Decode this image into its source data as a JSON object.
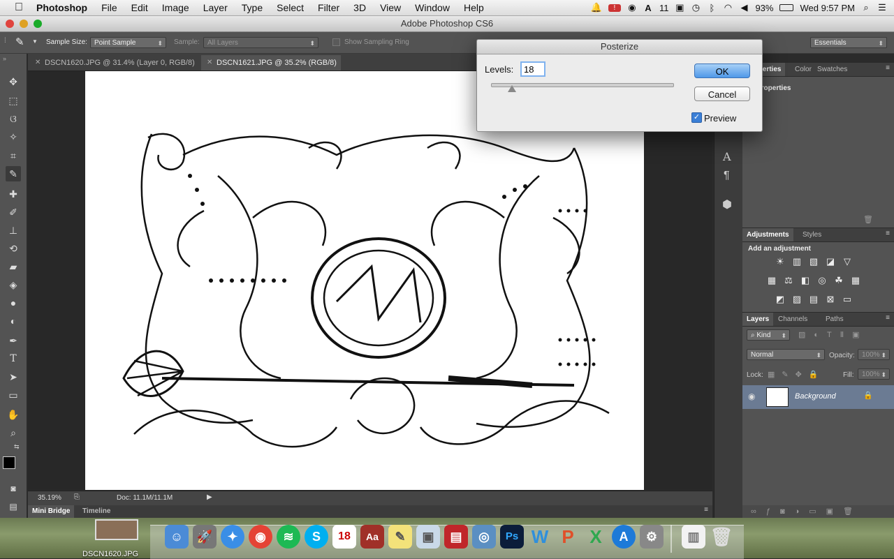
{
  "menubar": {
    "app_name": "Photoshop",
    "items": [
      "File",
      "Edit",
      "Image",
      "Layer",
      "Type",
      "Select",
      "Filter",
      "3D",
      "View",
      "Window",
      "Help"
    ],
    "status": {
      "adobe_count": "11",
      "battery": "93%",
      "clock": "Wed 9:57 PM"
    }
  },
  "window": {
    "title": "Adobe Photoshop CS6"
  },
  "options_bar": {
    "sample_size_label": "Sample Size:",
    "sample_size_value": "Point Sample",
    "sample_label": "Sample:",
    "sample_value": "All Layers",
    "show_sampling_ring": "Show Sampling Ring",
    "workspace": "Essentials"
  },
  "doc_tabs": [
    {
      "label": "DSCN1620.JPG @ 31.4% (Layer 0, RGB/8) *"
    },
    {
      "label": "DSCN1621.JPG @ 35.2% (RGB/8) *"
    }
  ],
  "status_bar": {
    "zoom": "35.19%",
    "doc_size": "Doc: 11.1M/11.1M"
  },
  "bottom_tabs": [
    "Mini Bridge",
    "Timeline"
  ],
  "panels": {
    "properties_tabs": [
      "Properties",
      "Color",
      "Swatches"
    ],
    "properties_title": "Properties",
    "adjustments_tabs": [
      "Adjustments",
      "Styles"
    ],
    "add_adjustment": "Add an adjustment",
    "layers_tabs": [
      "Layers",
      "Channels",
      "Paths"
    ],
    "kind": "Kind",
    "blend_mode": "Normal",
    "opacity_label": "Opacity:",
    "opacity_value": "100%",
    "lock_label": "Lock:",
    "fill_label": "Fill:",
    "fill_value": "100%",
    "layer_name": "Background"
  },
  "dialog": {
    "title": "Posterize",
    "levels_label": "Levels:",
    "levels_value": "18",
    "ok": "OK",
    "cancel": "Cancel",
    "preview": "Preview",
    "preview_checked": true,
    "slider_level": 18
  },
  "desktop": {
    "file_label": "DSCN1620.JPG",
    "calendar_day": "18"
  }
}
